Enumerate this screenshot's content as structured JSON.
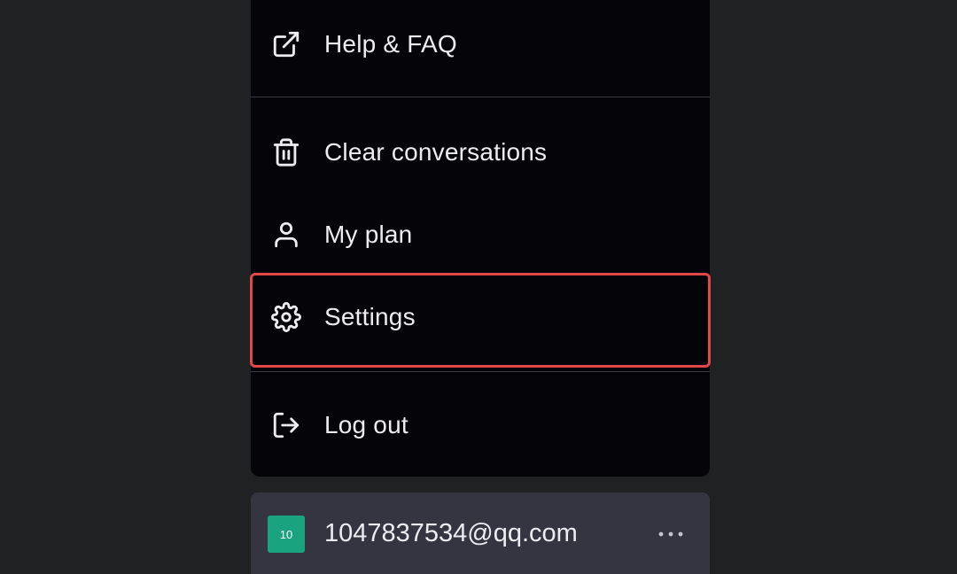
{
  "menu": {
    "items": [
      {
        "label": "Help & FAQ",
        "icon": "external-link-icon"
      },
      {
        "label": "Clear conversations",
        "icon": "trash-icon"
      },
      {
        "label": "My plan",
        "icon": "user-icon"
      },
      {
        "label": "Settings",
        "icon": "gear-icon"
      },
      {
        "label": "Log out",
        "icon": "log-out-icon"
      }
    ]
  },
  "user": {
    "avatar_text": "10",
    "email": "1047837534@qq.com",
    "more_icon": "ellipsis-icon"
  },
  "colors": {
    "background": "#202123",
    "menu_background": "#050509",
    "user_row_background": "#343541",
    "text": "#ececf1",
    "avatar": "#19a37f",
    "highlight": "#e04848"
  }
}
